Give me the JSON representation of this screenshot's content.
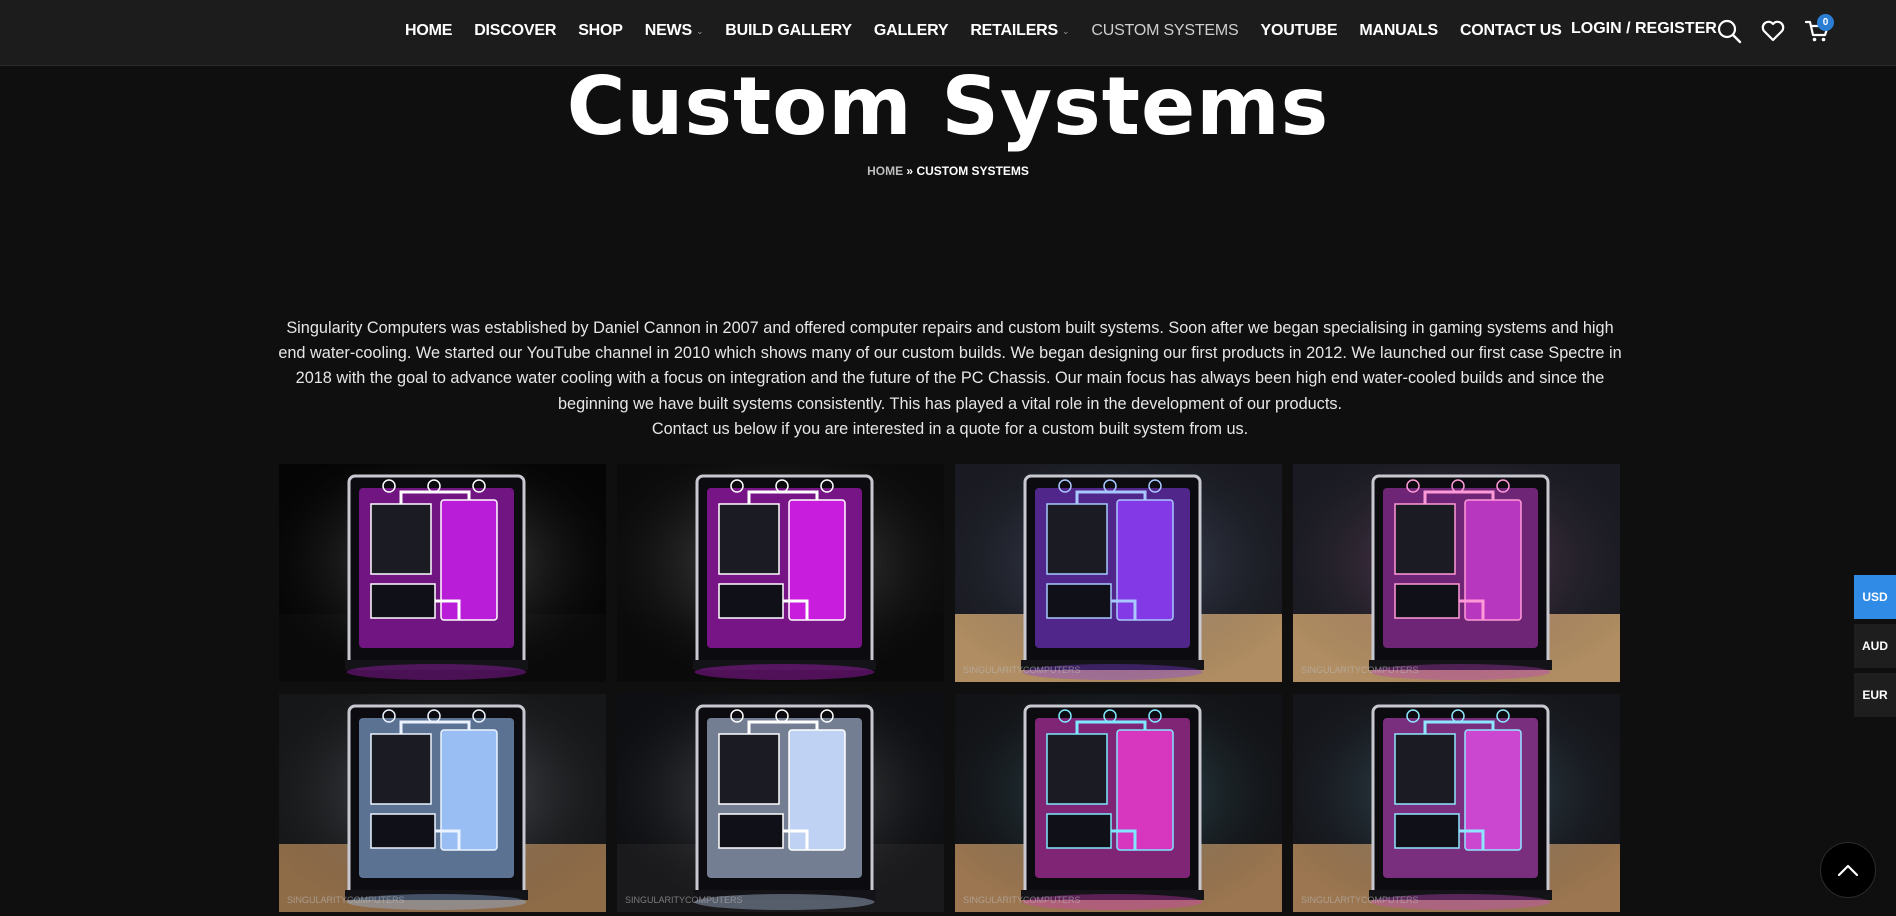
{
  "nav": {
    "items": [
      {
        "label": "HOME"
      },
      {
        "label": "DISCOVER"
      },
      {
        "label": "SHOP"
      },
      {
        "label": "NEWS",
        "has_dropdown": true
      },
      {
        "label": "BUILD GALLERY"
      },
      {
        "label": "GALLERY"
      },
      {
        "label": "RETAILERS",
        "has_dropdown": true
      },
      {
        "label": "CUSTOM SYSTEMS",
        "active": true
      },
      {
        "label": "YOUTUBE"
      },
      {
        "label": "MANUALS"
      },
      {
        "label": "CONTACT US"
      }
    ],
    "chevron": "⌄"
  },
  "account": {
    "login_label": "LOGIN / REGISTER",
    "cart_count": "0",
    "icons": [
      "search-icon",
      "heart-icon",
      "cart-icon"
    ]
  },
  "hero": {
    "title": "Custom Systems",
    "breadcrumb_home": "HOME",
    "breadcrumb_sep": " » ",
    "breadcrumb_current": "CUSTOM SYSTEMS"
  },
  "intro": {
    "paragraph": "Singularity Computers was established by Daniel Cannon in 2007 and offered computer repairs and custom built systems. Soon after we began specialising in gaming systems and high end water-cooling. We started our YouTube channel in 2010 which shows many of our custom builds. We began designing our first products in 2012. We launched our first case Spectre in 2018 with the goal to advance water cooling with a focus on integration and the future of the PC Chassis. Our main focus has always been high end water-cooled builds and since the beginning we have built systems consistently. This has played a vital role in the development of our products.",
    "cta": "Contact us below if you are interested in a quote for a custom built system from us."
  },
  "gallery": {
    "watermark": "SINGULARITYCOMPUTERS",
    "items": [
      {
        "accent": "#c21ee0",
        "glow": "#ffffff",
        "bg": "#050505",
        "floor": "#0a0a0a"
      },
      {
        "accent": "#d21ee8",
        "glow": "#ffffff",
        "bg": "#0b0b0b",
        "floor": "#0a0a0a"
      },
      {
        "accent": "#8a3cf0",
        "glow": "#a8c8ff",
        "bg": "#1a1b22",
        "floor": "#b08d62"
      },
      {
        "accent": "#c03ac8",
        "glow": "#ff9ad8",
        "bg": "#1a1b22",
        "floor": "#b08d62"
      },
      {
        "accent": "#9fc7ff",
        "glow": "#eaf3ff",
        "bg": "#161719",
        "floor": "#8f6c48"
      },
      {
        "accent": "#c9dcff",
        "glow": "#ffffff",
        "bg": "#0e0f12",
        "floor": "#1a1a1c"
      },
      {
        "accent": "#e038c8",
        "glow": "#7fe8ff",
        "bg": "#121316",
        "floor": "#9b7650"
      },
      {
        "accent": "#d44ad8",
        "glow": "#8fe6ff",
        "bg": "#15161b",
        "floor": "#9b7650"
      }
    ]
  },
  "currency": [
    "USD",
    "AUD",
    "EUR"
  ],
  "colors": {
    "background": "#0f0f10",
    "header": "#1c1c1d",
    "active_currency": "#2f8be6",
    "cart_badge": "#2a7fd4"
  }
}
